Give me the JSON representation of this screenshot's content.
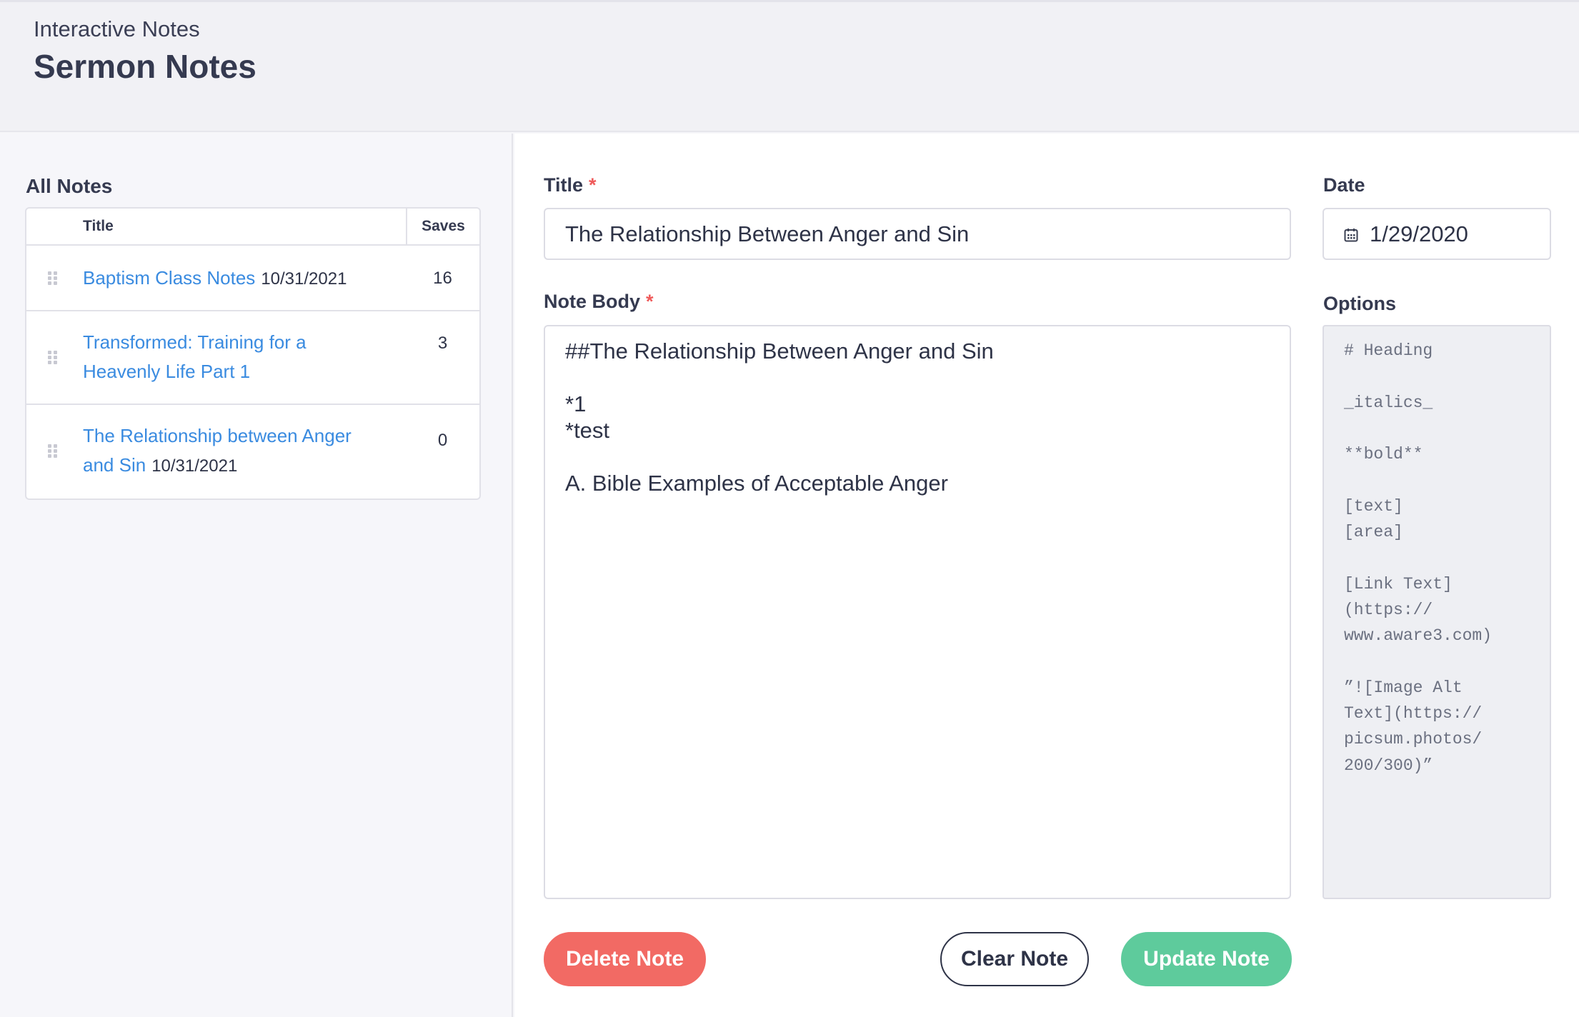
{
  "header": {
    "subtitle": "Interactive Notes",
    "title": "Sermon Notes"
  },
  "sidebar": {
    "label": "All Notes",
    "table": {
      "col_title": "Title",
      "col_saves": "Saves",
      "rows": [
        {
          "title": "Baptism Class Notes",
          "date": "10/31/2021",
          "saves": "16"
        },
        {
          "title": "Transformed: Training for a Heavenly Life Part 1",
          "date": "",
          "saves": "3"
        },
        {
          "title": "The Relationship between Anger and Sin",
          "date": "10/31/2021",
          "saves": "0"
        }
      ]
    }
  },
  "form": {
    "title_label": "Title",
    "required_mark": "*",
    "title_value": "The Relationship Between Anger and Sin",
    "date_label": "Date",
    "date_value": "1/29/2020",
    "body_label": "Note Body",
    "body_value": "##The Relationship Between Anger and Sin\n\n*1\n*test\n\nA. Bible Examples of Acceptable Anger",
    "options_label": "Options",
    "options_text": "# Heading\n\n_italics_\n\n**bold**\n\n[text]\n[area]\n\n[Link Text]\n(https://\nwww.aware3.com)\n\n”![Image Alt\nText](https://\npicsum.photos/\n200/300)”"
  },
  "buttons": {
    "delete": "Delete Note",
    "clear": "Clear Note",
    "update": "Update Note"
  },
  "colors": {
    "link": "#3a8be0",
    "required": "#ef5a5a",
    "delete": "#f26a64",
    "update": "#5ecb9c"
  }
}
